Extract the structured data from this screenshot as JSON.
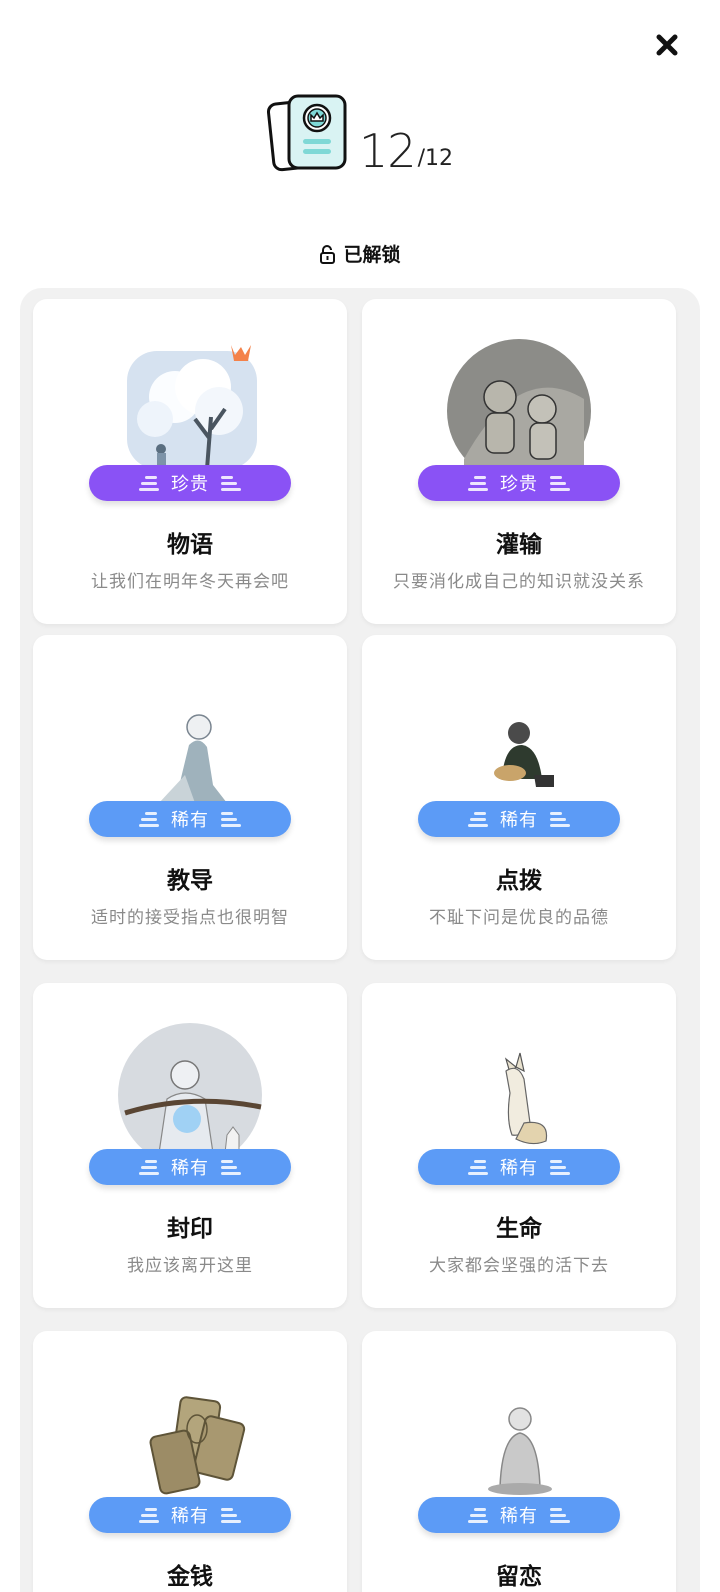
{
  "header": {
    "collected": "12",
    "total": "/12"
  },
  "section": {
    "unlocked_label": "已解锁"
  },
  "cards": [
    {
      "title": "物语",
      "desc": "让我们在明年冬天再会吧",
      "badge": "珍贵",
      "rarity": "rare",
      "badge_color": "#8a52f5",
      "art_icon": "snow-tree-icon",
      "has_crown": true
    },
    {
      "title": "灌输",
      "desc": "只要消化成自己的知识就没关系",
      "badge": "珍贵",
      "rarity": "rare",
      "badge_color": "#8a52f5",
      "art_icon": "children-sketch-icon",
      "has_crown": false
    },
    {
      "title": "教导",
      "desc": "适时的接受指点也很明智",
      "badge": "稀有",
      "rarity": "uncommon",
      "badge_color": "#5c9bf6",
      "art_icon": "kneeling-figure-icon",
      "has_crown": false
    },
    {
      "title": "点拨",
      "desc": "不耻下问是优良的品德",
      "badge": "稀有",
      "rarity": "uncommon",
      "badge_color": "#5c9bf6",
      "art_icon": "sitting-monk-icon",
      "has_crown": false
    },
    {
      "title": "封印",
      "desc": "我应该离开这里",
      "badge": "稀有",
      "rarity": "uncommon",
      "badge_color": "#5c9bf6",
      "art_icon": "sealed-figure-icon",
      "has_crown": false
    },
    {
      "title": "生命",
      "desc": "大家都会坚强的活下去",
      "badge": "稀有",
      "rarity": "uncommon",
      "badge_color": "#5c9bf6",
      "art_icon": "fox-icon",
      "has_crown": false
    },
    {
      "title": "金钱",
      "desc": "",
      "badge": "稀有",
      "rarity": "uncommon",
      "badge_color": "#5c9bf6",
      "art_icon": "coins-icon",
      "has_crown": false
    },
    {
      "title": "留恋",
      "desc": "",
      "badge": "稀有",
      "rarity": "uncommon",
      "badge_color": "#5c9bf6",
      "art_icon": "seated-statue-icon",
      "has_crown": false
    }
  ]
}
